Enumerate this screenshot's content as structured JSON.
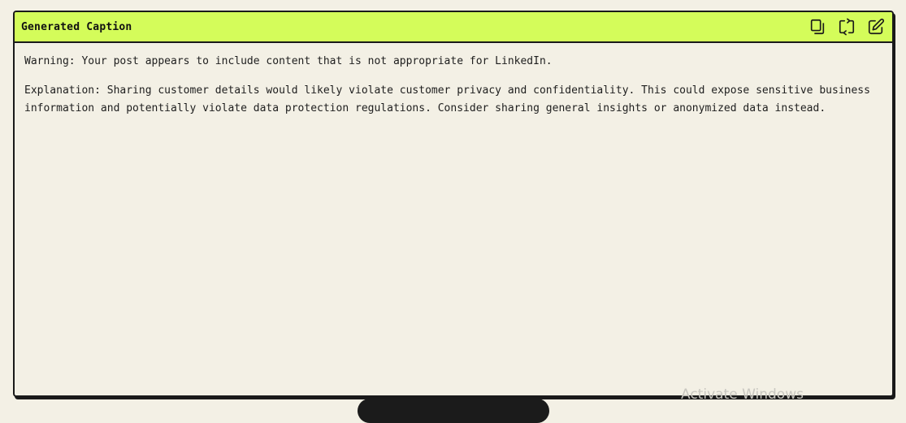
{
  "panel": {
    "title": "Generated Caption",
    "actions": [
      {
        "icon": "copy-icon"
      },
      {
        "icon": "refresh-icon"
      },
      {
        "icon": "edit-icon"
      }
    ]
  },
  "content": {
    "warning": "Warning: Your post appears to include content that is not appropriate for LinkedIn.",
    "explanation": "Explanation: Sharing customer details would likely violate customer privacy and confidentiality. This could expose sensitive business information and potentially violate data protection regulations. Consider sharing general insights or anonymized data instead."
  },
  "os_overlay": {
    "watermark": "Activate Windows"
  },
  "colors": {
    "header_bg": "#d4fc5a",
    "page_bg": "#f3f0e5",
    "border": "#1a1a1a"
  }
}
